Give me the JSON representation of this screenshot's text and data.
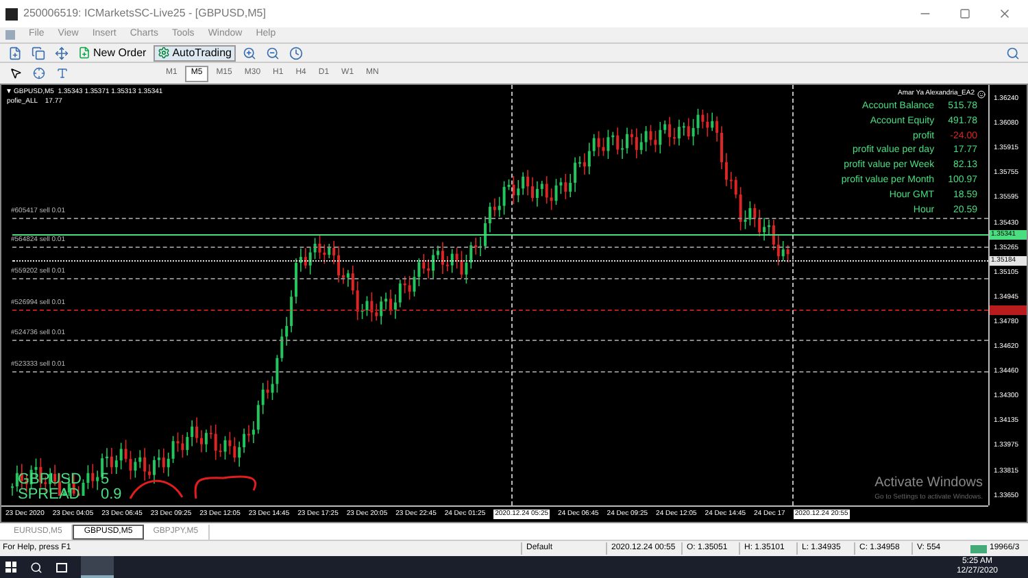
{
  "window": {
    "title": "250006519: ICMarketsSC-Live25 - [GBPUSD,M5]"
  },
  "menu": [
    "File",
    "View",
    "Insert",
    "Charts",
    "Tools",
    "Window",
    "Help"
  ],
  "toolbar": {
    "new_order": "New Order",
    "autotrading": "AutoTrading"
  },
  "timeframes": [
    {
      "label": "M1",
      "selected": false
    },
    {
      "label": "M5",
      "selected": true
    },
    {
      "label": "M15",
      "selected": false
    },
    {
      "label": "M30",
      "selected": false
    },
    {
      "label": "H1",
      "selected": false
    },
    {
      "label": "H4",
      "selected": false
    },
    {
      "label": "D1",
      "selected": false
    },
    {
      "label": "W1",
      "selected": false
    },
    {
      "label": "MN",
      "selected": false
    }
  ],
  "chart": {
    "dropdown": "▼",
    "header": "GBPUSD,M5  1.35343 1.35371 1.35313 1.35341",
    "indicator": "pofie_ALL    17.77",
    "expert": "Amar Ya Alexandria_EA2",
    "info": [
      {
        "label": "Account Balance",
        "value": "515.78",
        "negative": false
      },
      {
        "label": "Account Equity",
        "value": "491.78",
        "negative": false
      },
      {
        "label": "profit",
        "value": "-24.00",
        "negative": true
      },
      {
        "label": "profit value per day",
        "value": "17.77",
        "negative": false
      },
      {
        "label": "profit value per Week",
        "value": "82.13",
        "negative": false
      },
      {
        "label": "profit value per Month",
        "value": "100.97",
        "negative": false
      },
      {
        "label": "Hour GMT",
        "value": "18.59",
        "negative": false
      },
      {
        "label": "Hour",
        "value": "20.59",
        "negative": false
      }
    ],
    "lines": [
      {
        "kind": "order",
        "label": "#605417 sell 0.01",
        "color": "#8a8a8a"
      },
      {
        "kind": "bid",
        "tag": "1.35341",
        "color": "#4ade80"
      },
      {
        "kind": "order",
        "label": "#564824 sell 0.01",
        "color": "#8a8a8a"
      },
      {
        "kind": "dotted",
        "tag": "1.35184",
        "color": "#e5e5e5"
      },
      {
        "kind": "order",
        "label": "#559202 sell 0.01",
        "color": "#8a8a8a"
      },
      {
        "kind": "stop",
        "label": "#526994 sell 0.01",
        "color": "#b91c1c"
      },
      {
        "kind": "order",
        "label": "#524736 sell 0.01",
        "color": "#8a8a8a"
      },
      {
        "kind": "order",
        "label": "#523333 sell 0.01",
        "color": "#8a8a8a"
      }
    ],
    "prices": [
      "1.36240",
      "1.36080",
      "1.35915",
      "1.35755",
      "1.35595",
      "1.35430",
      "1.35265",
      "1.35105",
      "1.34945",
      "1.34780",
      "1.34620",
      "1.34460",
      "1.34300",
      "1.34135",
      "1.33975",
      "1.33815",
      "1.33650"
    ],
    "symbol": [
      {
        "label": "GBPUSD",
        "value": "5"
      },
      {
        "label": "SPREAD",
        "value": "0.9"
      }
    ],
    "times": [
      {
        "label": "23 Dec 2020",
        "highlight": false
      },
      {
        "label": "23 Dec 04:05",
        "highlight": false
      },
      {
        "label": "23 Dec 06:45",
        "highlight": false
      },
      {
        "label": "23 Dec 09:25",
        "highlight": false
      },
      {
        "label": "23 Dec 12:05",
        "highlight": false
      },
      {
        "label": "23 Dec 14:45",
        "highlight": false
      },
      {
        "label": "23 Dec 17:25",
        "highlight": false
      },
      {
        "label": "23 Dec 20:05",
        "highlight": false
      },
      {
        "label": "23 Dec 22:45",
        "highlight": false
      },
      {
        "label": "24 Dec 01:25",
        "highlight": false
      },
      {
        "label": "2020.12.24 05:25",
        "highlight": true
      },
      {
        "label": "24 Dec 06:45",
        "highlight": false
      },
      {
        "label": "24 Dec 09:25",
        "highlight": false
      },
      {
        "label": "24 Dec 12:05",
        "highlight": false
      },
      {
        "label": "24 Dec 14:45",
        "highlight": false
      },
      {
        "label": "24 Dec 17",
        "highlight": false
      },
      {
        "label": "2020.12.24 20:55",
        "highlight": true
      }
    ]
  },
  "activation": {
    "title": "Activate Windows",
    "hint": "Go to Settings to activate Windows."
  },
  "chart_tabs": [
    {
      "label": "EURUSD,M5",
      "selected": false
    },
    {
      "label": "GBPUSD,M5",
      "selected": true
    },
    {
      "label": "GBPJPY,M5",
      "selected": false
    }
  ],
  "status_bar": {
    "help": "For Help, press F1",
    "profile": "Default",
    "time": "2020.12.24 00:55",
    "open": "O: 1.35051",
    "high": "H: 1.35101",
    "low": "L: 1.34935",
    "close": "C: 1.34958",
    "volume": "V: 554",
    "traffic": "19966/3"
  },
  "taskbar": {
    "time": "5:25 AM",
    "date": "12/27/2020"
  }
}
